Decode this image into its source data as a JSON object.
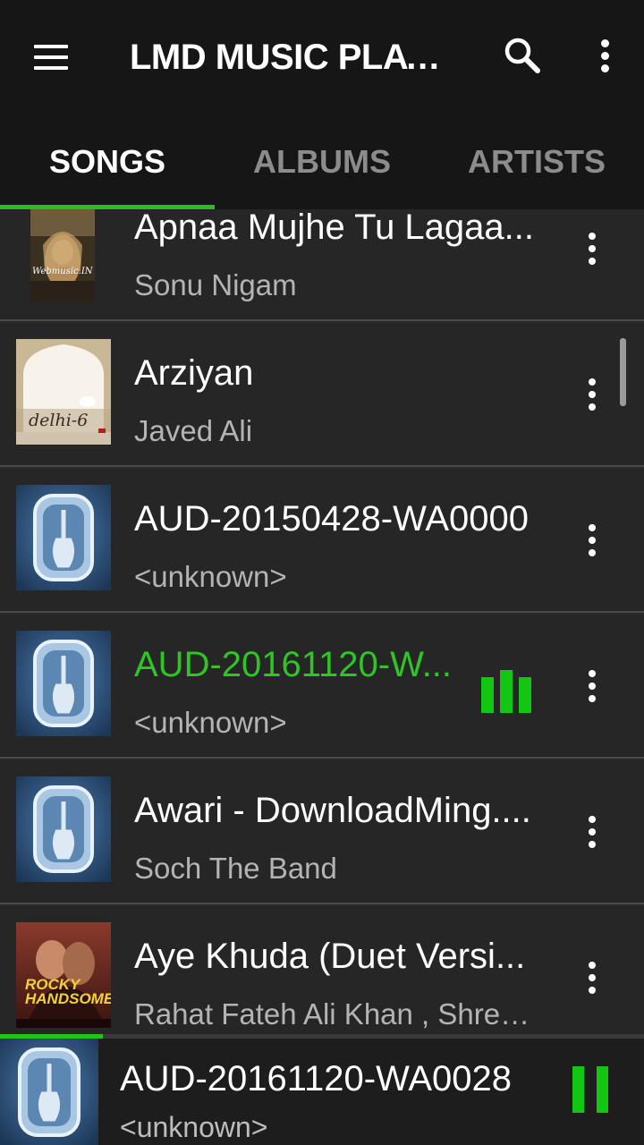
{
  "app": {
    "title": "LMD MUSIC PLAY...",
    "icons": {
      "menu": "hamburger-menu-icon",
      "search": "search-icon",
      "overflow": "more-vert-icon"
    }
  },
  "tabs": [
    {
      "label": "SONGS",
      "active": true
    },
    {
      "label": "ALBUMS",
      "active": false
    },
    {
      "label": "ARTISTS",
      "active": false
    }
  ],
  "songs": [
    {
      "title": "Apnaa Mujhe Tu Lagaa...",
      "artist": "Sonu Nigam",
      "art": "1920-album-cover",
      "art_text": "Webmusic.IN"
    },
    {
      "title": "Arziyan",
      "artist": "Javed Ali",
      "art": "delhi-6-album-cover",
      "art_text": "delhi-6"
    },
    {
      "title": "AUD-20150428-WA0000",
      "artist": "<unknown>",
      "art": "default-guitar-cover"
    },
    {
      "title": "AUD-20161120-W...",
      "artist": "<unknown>",
      "art": "default-guitar-cover",
      "playing": true
    },
    {
      "title": "Awari - DownloadMing....",
      "artist": "Soch The Band",
      "art": "default-guitar-cover"
    },
    {
      "title": "Aye Khuda (Duet Versi...",
      "artist": "Rahat Fateh Ali Khan , Shrey...",
      "art": "rocky-handsome-album-cover",
      "art_text": "ROCKY HANDSOME"
    }
  ],
  "now_playing": {
    "title": "AUD-20161120-WA0028",
    "artist": "<unknown>",
    "progress": 0.16,
    "state": "playing"
  },
  "colors": {
    "accent": "#24c31a",
    "appbar": "#161616",
    "row_bg": "#262626",
    "divider": "#4a4a4a",
    "subtext": "#b4b4b4"
  }
}
